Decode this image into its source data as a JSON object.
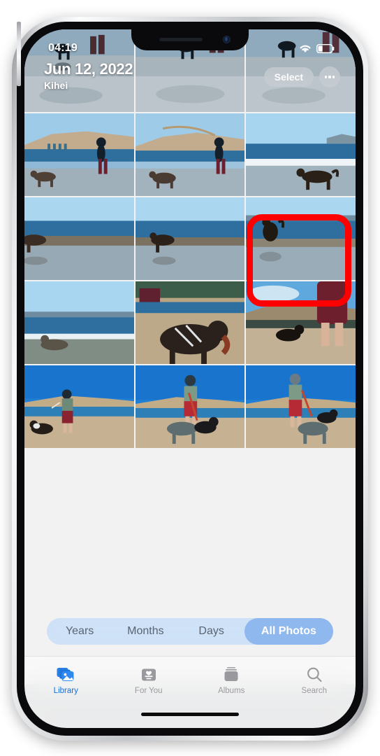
{
  "device": {
    "name": "iphone-silver",
    "buttons": [
      "silent-switch",
      "volume-up",
      "volume-down",
      "power-button"
    ]
  },
  "status_bar": {
    "time": "04:19",
    "wifi_icon": "wifi-icon",
    "battery_icon": "battery-icon",
    "battery_level_percent": 25
  },
  "header": {
    "date_title": "Jun 12, 2022",
    "location": "Kihei",
    "select_label": "Select",
    "more_icon": "ellipsis-icon"
  },
  "annotation": {
    "type": "red-highlight-box",
    "color": "#ff0000",
    "target": "photo-row2-col3"
  },
  "segmented_control": {
    "options": [
      {
        "label": "Years",
        "active": false
      },
      {
        "label": "Months",
        "active": false
      },
      {
        "label": "Days",
        "active": false
      },
      {
        "label": "All Photos",
        "active": true
      }
    ],
    "selected": "All Photos",
    "selected_bg": "#8fb8ef",
    "track_bg": "#cbe0f7"
  },
  "tab_bar": {
    "items": [
      {
        "label": "Library",
        "icon": "photo-stack-icon",
        "active": true
      },
      {
        "label": "For You",
        "icon": "heart-card-icon",
        "active": false
      },
      {
        "label": "Albums",
        "icon": "albums-icon",
        "active": false
      },
      {
        "label": "Search",
        "icon": "magnifier-icon",
        "active": false
      }
    ],
    "active_color": "#1271e0",
    "inactive_color": "#9a9a9e"
  },
  "photo_grid": {
    "columns": 3,
    "description": "Beach photos of a man playing with dogs at the shoreline",
    "photos": [
      {
        "id": "photo-r1-c1",
        "scene": "man-throwing-stick-dog-sand"
      },
      {
        "id": "photo-r1-c2",
        "scene": "man-throwing-stick-dog-sand"
      },
      {
        "id": "photo-r1-c3",
        "scene": "man-walking-dog-sand"
      },
      {
        "id": "photo-r2-c1",
        "scene": "man-and-dog-running-shoreline"
      },
      {
        "id": "photo-r2-c2",
        "scene": "man-swinging-stick-dog-shoreline"
      },
      {
        "id": "photo-r2-c3",
        "scene": "dog-running-in-surf",
        "highlighted": true
      },
      {
        "id": "photo-r3-c1",
        "scene": "dog-running-in-waves"
      },
      {
        "id": "photo-r3-c2",
        "scene": "dog-running-in-waves"
      },
      {
        "id": "photo-r3-c3",
        "scene": "dog-leaping-in-waves"
      },
      {
        "id": "photo-r4-c1",
        "scene": "dog-splashing-in-water"
      },
      {
        "id": "photo-r4-c2",
        "scene": "closeup-dog-with-harness-carrying-stick"
      },
      {
        "id": "photo-r5-c1",
        "scene": "man-walking-dog-on-beach"
      },
      {
        "id": "photo-r5-c2",
        "scene": "man-standing-with-two-dogs"
      },
      {
        "id": "photo-r5-c3",
        "scene": "man-standing-with-two-dogs"
      }
    ]
  }
}
